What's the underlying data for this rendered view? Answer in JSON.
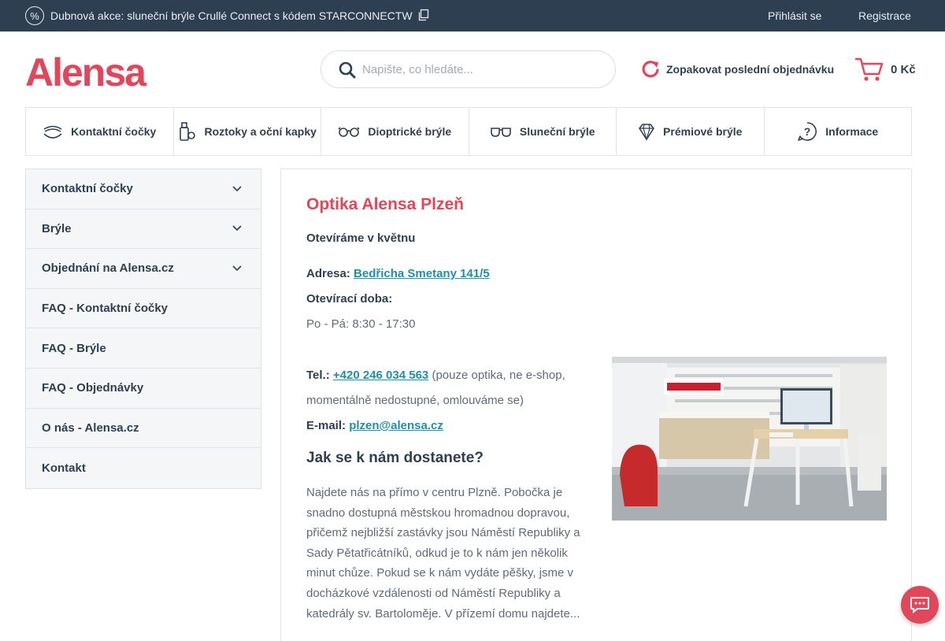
{
  "topbar": {
    "promo_text": "Dubnová akce: sluneční brýle Crullé Connect s kódem STARCONNECTW",
    "login_label": "Přihlásit se",
    "register_label": "Registrace"
  },
  "header": {
    "logo_text": "Alensa",
    "search_placeholder": "Napište, co hledáte...",
    "reorder_label": "Zopakovat poslední objednávku",
    "cart_total": "0 Kč"
  },
  "categories": [
    {
      "label": "Kontaktní čočky",
      "icon": "contact-lens-icon"
    },
    {
      "label": "Roztoky a oční kapky",
      "icon": "solution-bottle-icon"
    },
    {
      "label": "Dioptrické brýle",
      "icon": "eyeglasses-icon"
    },
    {
      "label": "Sluneční brýle",
      "icon": "sunglasses-icon"
    },
    {
      "label": "Prémiové brýle",
      "icon": "diamond-icon"
    },
    {
      "label": "Informace",
      "icon": "help-icon"
    }
  ],
  "sidebar": {
    "items": [
      {
        "label": "Kontaktní čočky",
        "expandable": true
      },
      {
        "label": "Brýle",
        "expandable": true
      },
      {
        "label": "Objednání na Alensa.cz",
        "expandable": true
      },
      {
        "label": "FAQ - Kontaktní čočky",
        "expandable": false
      },
      {
        "label": "FAQ - Brýle",
        "expandable": false
      },
      {
        "label": "FAQ - Objednávky",
        "expandable": false
      },
      {
        "label": "O nás - Alensa.cz",
        "expandable": false
      },
      {
        "label": "Kontakt",
        "expandable": false
      }
    ]
  },
  "main": {
    "title": "Optika Alensa Plzeň",
    "subtitle": "Otevíráme v květnu",
    "address_label": "Adresa:",
    "address_value": "Bedřicha Smetany 141/5",
    "hours_label": "Otevírací doba:",
    "hours_value": "Po - Pá: 8:30 - 17:30",
    "tel_label": "Tel.:",
    "tel_value": "+420 246 034 563",
    "tel_note": "(pouze optika, ne e-shop, momentálně nedostupné, omlouváme se)",
    "email_label": "E-mail:",
    "email_value": "plzen@alensa.cz",
    "directions_heading": "Jak se k nám dostanete?",
    "directions_text": "Najdete nás na přímo v centru Plzně. Pobočka je snadno dostupná městskou hromadnou dopravou, přičemž nejbližší zastávky jsou Náměstí Republiky a Sady Pětatřicátníků, odkud je to k nám jen několik minut chůze. Pokud se k nám vydáte pěšky, jsme v docházkové vzdálenosti od Náměstí Republiky a katedrály sv. Bartoloměje. V přízemí domu najdete..."
  },
  "colors": {
    "brand_red": "#e0475a",
    "nav_dark": "#2f3f52",
    "link_teal": "#1f8fa8"
  }
}
